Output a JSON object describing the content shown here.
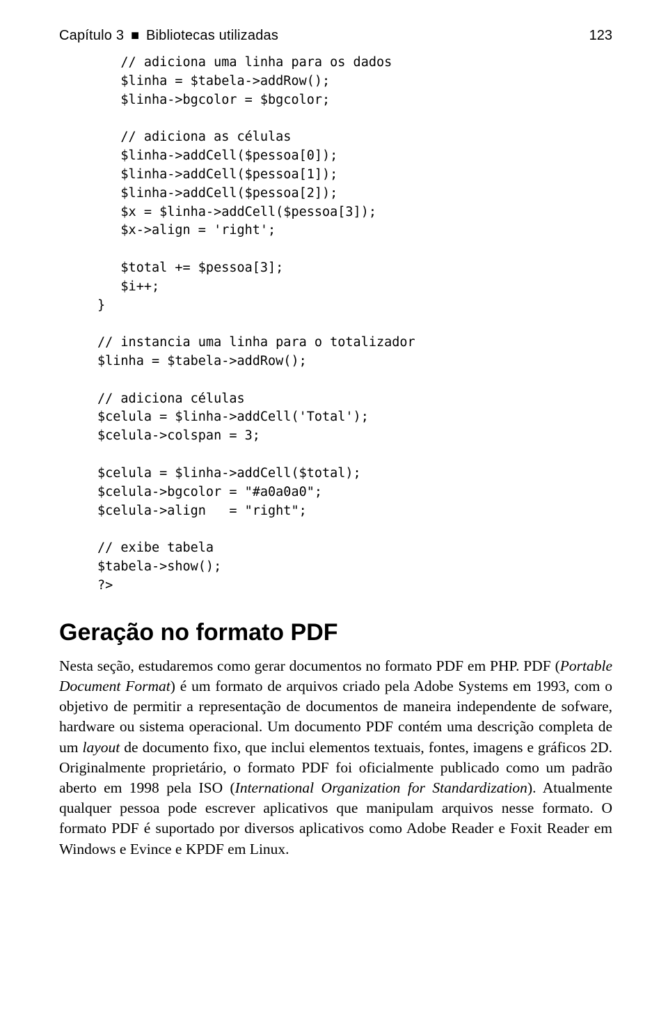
{
  "header": {
    "chapter_label": "Capítulo 3",
    "separator": "■",
    "chapter_title": "Bibliotecas utilizadas",
    "page_number": "123"
  },
  "code": {
    "lines": [
      {
        "indent": 1,
        "text": "// adiciona uma linha para os dados"
      },
      {
        "indent": 1,
        "text": "$linha = $tabela->addRow();"
      },
      {
        "indent": 1,
        "text": "$linha->bgcolor = $bgcolor;"
      },
      {
        "indent": 1,
        "text": ""
      },
      {
        "indent": 1,
        "text": "// adiciona as células"
      },
      {
        "indent": 1,
        "text": "$linha->addCell($pessoa[0]);"
      },
      {
        "indent": 1,
        "text": "$linha->addCell($pessoa[1]);"
      },
      {
        "indent": 1,
        "text": "$linha->addCell($pessoa[2]);"
      },
      {
        "indent": 1,
        "text": "$x = $linha->addCell($pessoa[3]);"
      },
      {
        "indent": 1,
        "text": "$x->align = 'right';"
      },
      {
        "indent": 1,
        "text": ""
      },
      {
        "indent": 1,
        "text": "$total += $pessoa[3];"
      },
      {
        "indent": 1,
        "text": "$i++;"
      },
      {
        "indent": 0,
        "text": "}"
      },
      {
        "indent": 0,
        "text": ""
      },
      {
        "indent": 0,
        "text": "// instancia uma linha para o totalizador"
      },
      {
        "indent": 0,
        "text": "$linha = $tabela->addRow();"
      },
      {
        "indent": 0,
        "text": ""
      },
      {
        "indent": 0,
        "text": "// adiciona células"
      },
      {
        "indent": 0,
        "text": "$celula = $linha->addCell('Total');"
      },
      {
        "indent": 0,
        "text": "$celula->colspan = 3;"
      },
      {
        "indent": 0,
        "text": ""
      },
      {
        "indent": 0,
        "text": "$celula = $linha->addCell($total);"
      },
      {
        "indent": 0,
        "text": "$celula->bgcolor = \"#a0a0a0\";"
      },
      {
        "indent": 0,
        "text": "$celula->align   = \"right\";"
      },
      {
        "indent": 0,
        "text": ""
      },
      {
        "indent": 0,
        "text": "// exibe tabela"
      },
      {
        "indent": 0,
        "text": "$tabela->show();"
      },
      {
        "indent": 0,
        "text": "?>"
      }
    ]
  },
  "section": {
    "heading": "Geração no formato PDF",
    "paragraph_parts": [
      {
        "t": "Nesta seção, estudaremos como gerar documentos no formato PDF em PHP. PDF (",
        "i": false
      },
      {
        "t": "Portable Document Format",
        "i": true
      },
      {
        "t": ") é um formato de arquivos criado pela Adobe Systems em 1993, com o objetivo de permitir a representação de documentos de maneira independente de sofware, hardware ou sistema operacional. Um documento PDF contém uma descrição completa de um ",
        "i": false
      },
      {
        "t": "layout",
        "i": true
      },
      {
        "t": " de documento fixo, que inclui elementos textuais, fontes, imagens e gráficos 2D. Originalmente proprietário, o formato PDF foi oficialmente publicado como um padrão aberto em 1998 pela ISO (",
        "i": false
      },
      {
        "t": "International Organization for Standardization",
        "i": true
      },
      {
        "t": "). Atualmente qualquer pessoa pode escrever aplicativos que manipulam arquivos nesse formato. O formato PDF é suportado por diversos aplicativos como Adobe Reader e Foxit Reader em Windows e Evince e KPDF em Linux.",
        "i": false
      }
    ]
  }
}
